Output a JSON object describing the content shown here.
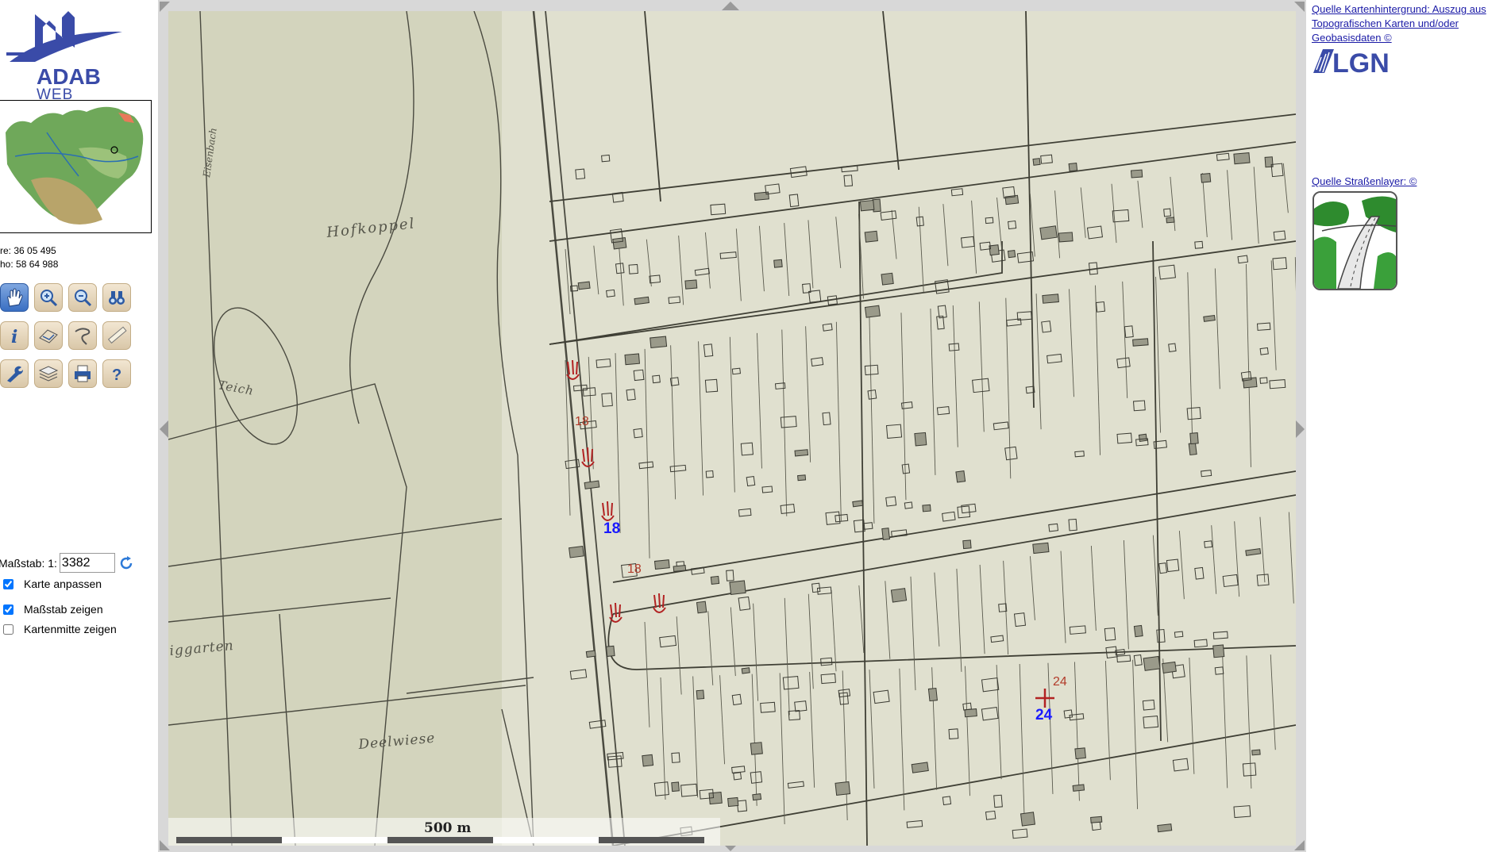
{
  "logo": {
    "line1": "ADAB",
    "line2": "WEB"
  },
  "coordinates": {
    "re": "re: 36 05 495",
    "ho": "ho: 58 64 988"
  },
  "toolbar": {
    "tools": [
      "pan-tool",
      "zoom-in-tool",
      "zoom-out-tool",
      "binoculars-tool",
      "info-tool",
      "select-area-tool",
      "select-line-tool",
      "measure-tool",
      "settings-tool",
      "layers-tool",
      "print-tool",
      "help-tool"
    ],
    "help_label": "?",
    "info_label": "i"
  },
  "scale": {
    "label": "Maßstab: 1:",
    "value": "3382"
  },
  "options": {
    "fit_map": {
      "label": "Karte anpassen",
      "checked": true
    },
    "show_scale": {
      "label": "Maßstab zeigen",
      "checked": true
    },
    "show_center": {
      "label": "Kartenmitte zeigen",
      "checked": false
    }
  },
  "map": {
    "place_labels": [
      "Hofkoppel",
      "Teich",
      "Deelwiese",
      "iggarten",
      "Eisenbach"
    ],
    "site_labels": [
      "18",
      "24"
    ],
    "scalebar_label": "500 m",
    "colors": {
      "paper": "#dcdccb",
      "site_marker": "#b22222",
      "site_label": "#1a1aff",
      "scale_dark": "#555555",
      "scale_light": "#ffffff"
    }
  },
  "sources": {
    "background": "Quelle Kartenhintergrund: Auszug aus Topografischen Karten und/oder Geobasisdaten ©",
    "background_logo": "LGN",
    "streets": "Quelle Straßenlayer: ©"
  }
}
